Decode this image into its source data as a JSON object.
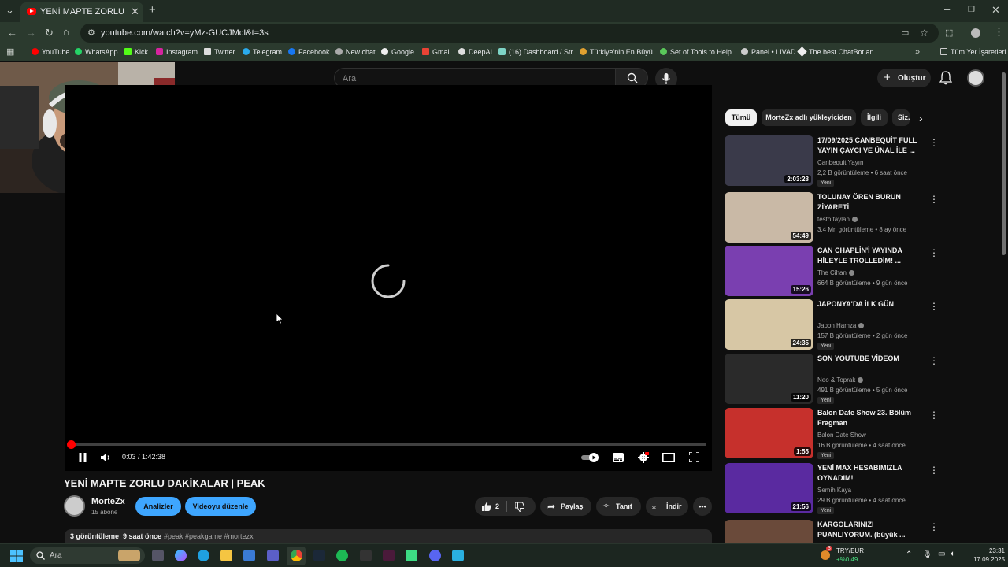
{
  "browser": {
    "tab_title": "YENİ MAPTE ZORLU DAKİKALAR",
    "url": "youtube.com/watch?v=yMz-GUCJMcI&t=3s",
    "bookmarks": [
      "YouTube",
      "WhatsApp",
      "Kick",
      "Instagram",
      "Twitter",
      "Telegram",
      "Facebook",
      "New chat",
      "Google",
      "Gmail",
      "DeepAI",
      "(16) Dashboard / Str...",
      "Türkiye'nin En Büyü...",
      "Set of Tools to Help...",
      "Panel • LIVAD",
      "The best ChatBot an..."
    ],
    "all_bookmarks": "Tüm Yer İşaretleri"
  },
  "youtube": {
    "search_placeholder": "Ara",
    "create_label": "Oluştur",
    "player": {
      "time": "0:03 / 1:42:38",
      "progress_fraction": 0.0005
    },
    "video": {
      "title": "YENİ MAPTE ZORLU DAKİKALAR | PEAK",
      "channel": "MorteZx",
      "subs": "15 abone",
      "analytics_label": "Analizler",
      "edit_label": "Videoyu düzenle",
      "likes": "2",
      "share_label": "Paylaş",
      "promote_label": "Tanıt",
      "download_label": "İndir",
      "views": "3 görüntüleme",
      "age": "9 saat önce",
      "tags": "#peak #peakgame #mortezx"
    },
    "chips": [
      "Tümü",
      "MorteZx adlı yükleyiciden",
      "İlgili",
      "Siz..."
    ],
    "recommended": [
      {
        "title": "17/09/2025 CANBEQUİT FULL YAYIN ÇAYCI VE ÜNAL İLE ...",
        "channel": "Canbequit Yayın",
        "verified": false,
        "meta": "2,2 B görüntüleme • 6 saat önce",
        "badge": "Yeni",
        "duration": "2:03:28",
        "color": "#3a3a4a"
      },
      {
        "title": "TOLUNAY ÖREN BURUN ZİYARETİ",
        "channel": "testo taylan",
        "verified": true,
        "meta": "3,4 Mn görüntüleme • 8 ay önce",
        "badge": "",
        "duration": "54:49",
        "color": "#c9b9a6"
      },
      {
        "title": "CAN CHAPLİN'İ YAYINDA HİLEYLE TROLLEDİM! ...",
        "channel": "The Cihan",
        "verified": true,
        "meta": "664 B görüntüleme • 9 gün önce",
        "badge": "",
        "duration": "15:26",
        "color": "#7a3fb0"
      },
      {
        "title": "JAPONYA'DA İLK GÜN",
        "channel": "Japon Hamza",
        "verified": true,
        "meta": "157 B görüntüleme • 2 gün önce",
        "badge": "Yeni",
        "duration": "24:35",
        "color": "#d7c7a5"
      },
      {
        "title": "SON YOUTUBE VİDEOM",
        "channel": "Neo & Toprak",
        "verified": true,
        "meta": "491 B görüntüleme • 5 gün önce",
        "badge": "Yeni",
        "duration": "11:20",
        "color": "#2a2a2a"
      },
      {
        "title": "Balon Date Show 23. Bölüm Fragman",
        "channel": "Balon Date Show",
        "verified": false,
        "meta": "16 B görüntüleme • 4 saat önce",
        "badge": "Yeni",
        "duration": "1:55",
        "color": "#c6302c"
      },
      {
        "title": "YENİ MAX HESABIMIZLA OYNADIM!",
        "channel": "Semih Kaya",
        "verified": false,
        "meta": "29 B görüntüleme • 4 saat önce",
        "badge": "Yeni",
        "duration": "21:56",
        "color": "#5a2aa0"
      },
      {
        "title": "KARGOLARINIZI PUANLIYORUM. (büyük ...",
        "channel": "",
        "verified": false,
        "meta": "",
        "badge": "",
        "duration": "",
        "color": "#6a4a3a"
      }
    ]
  },
  "taskbar": {
    "search_label": "Ara",
    "currency_label": "TRY/EUR",
    "currency_change": "+%0,49",
    "notif_count": "3",
    "time": "23:31",
    "date": "17.09.2025"
  },
  "colors": {
    "accent_blue": "#3ea6ff",
    "progress_red": "#ff0000",
    "chrome_bg": "#2b3a2e"
  }
}
